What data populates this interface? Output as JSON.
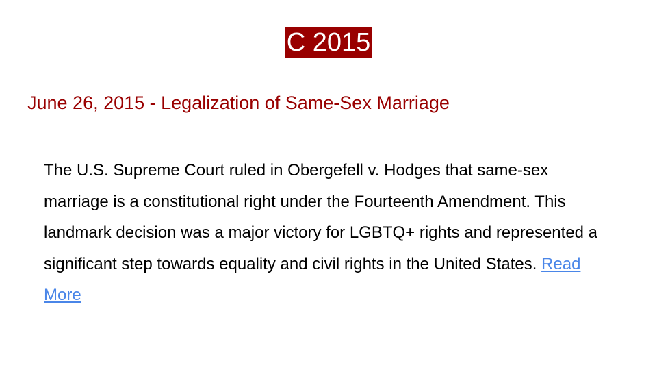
{
  "slide": {
    "title": "C 2015",
    "subtitle": "June 26, 2015 - Legalization of Same-Sex Marriage",
    "body": "The U.S. Supreme Court ruled in Obergefell v. Hodges that same-sex marriage is a constitutional right under the Fourteenth Amendment. This landmark decision was a major victory for LGBTQ+ rights and represented a significant step towards equality and civil rights in the United States.",
    "link_label": "Read More"
  },
  "colors": {
    "title_background": "#990000",
    "title_text": "#ffffff",
    "subtitle_text": "#990000",
    "link": "#4a86e8"
  }
}
